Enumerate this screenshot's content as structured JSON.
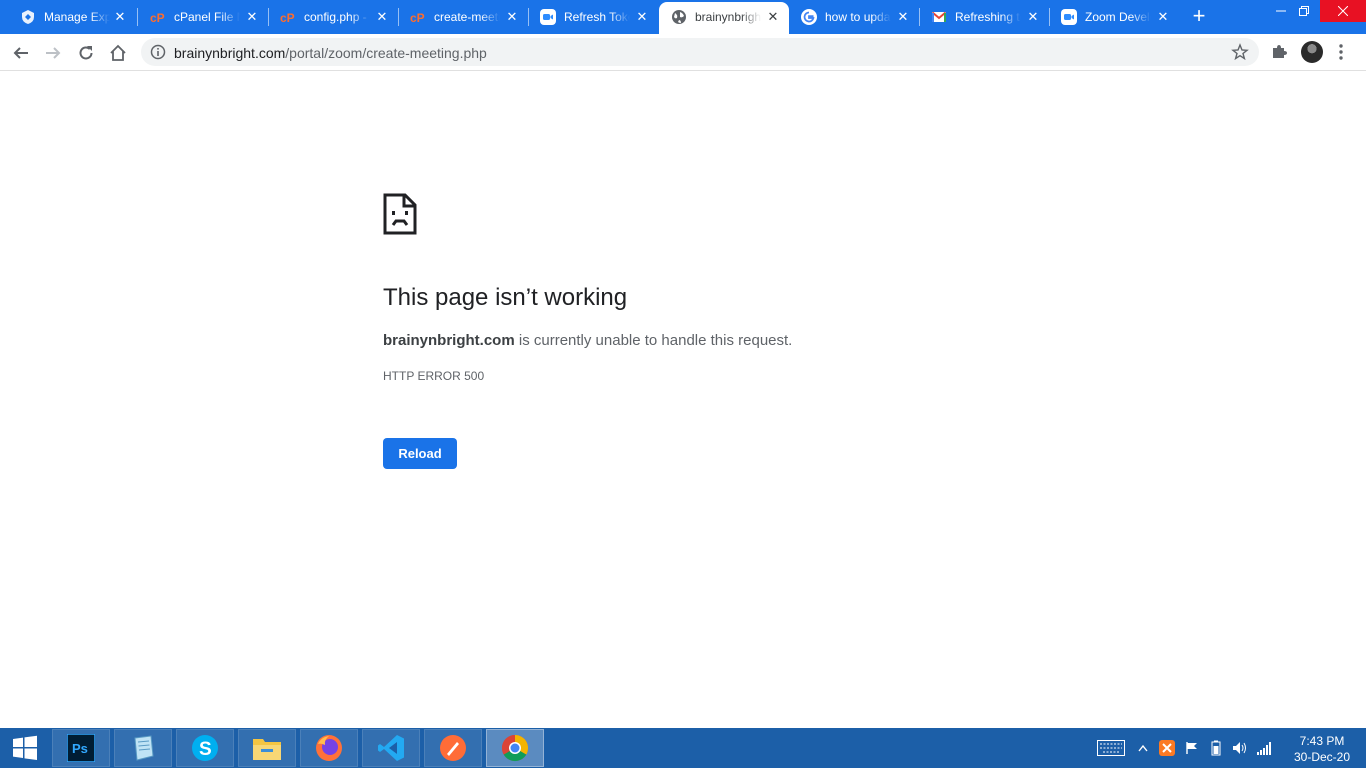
{
  "browser": {
    "tabs": [
      {
        "title": "Manage Expense Types",
        "icon": "dev-shield-icon",
        "active": false
      },
      {
        "title": "cPanel File Manager",
        "icon": "cpanel-icon",
        "active": false
      },
      {
        "title": "config.php - cPanel",
        "icon": "cpanel-icon",
        "active": false
      },
      {
        "title": "create-meeting.php",
        "icon": "cpanel-icon",
        "active": false
      },
      {
        "title": "Refresh Token",
        "icon": "zoom-icon",
        "active": false
      },
      {
        "title": "brainynbright.com",
        "icon": "globe-icon",
        "active": true
      },
      {
        "title": "how to update",
        "icon": "google-icon",
        "active": false
      },
      {
        "title": "Refreshing token",
        "icon": "gmail-icon",
        "active": false
      },
      {
        "title": "Zoom Developer",
        "icon": "zoom-icon",
        "active": false
      }
    ],
    "url_host": "brainynbright.com",
    "url_path": "/portal/zoom/create-meeting.php"
  },
  "error_page": {
    "heading": "This page isn’t working",
    "host": "brainynbright.com",
    "description": " is currently unable to handle this request.",
    "error_code": "HTTP ERROR 500",
    "reload_label": "Reload"
  },
  "taskbar": {
    "apps": [
      "photoshop-icon",
      "notepad-icon",
      "skype-icon",
      "file-explorer-icon",
      "firefox-icon",
      "vscode-icon",
      "postman-icon",
      "chrome-icon"
    ],
    "photoshop_label": "Ps",
    "skype_label": "S",
    "clock_time": "7:43 PM",
    "clock_date": "30-Dec-20"
  },
  "colors": {
    "chrome_blue": "#1a73e8",
    "taskbar_blue": "#1c5fa8",
    "close_red": "#e81123"
  }
}
